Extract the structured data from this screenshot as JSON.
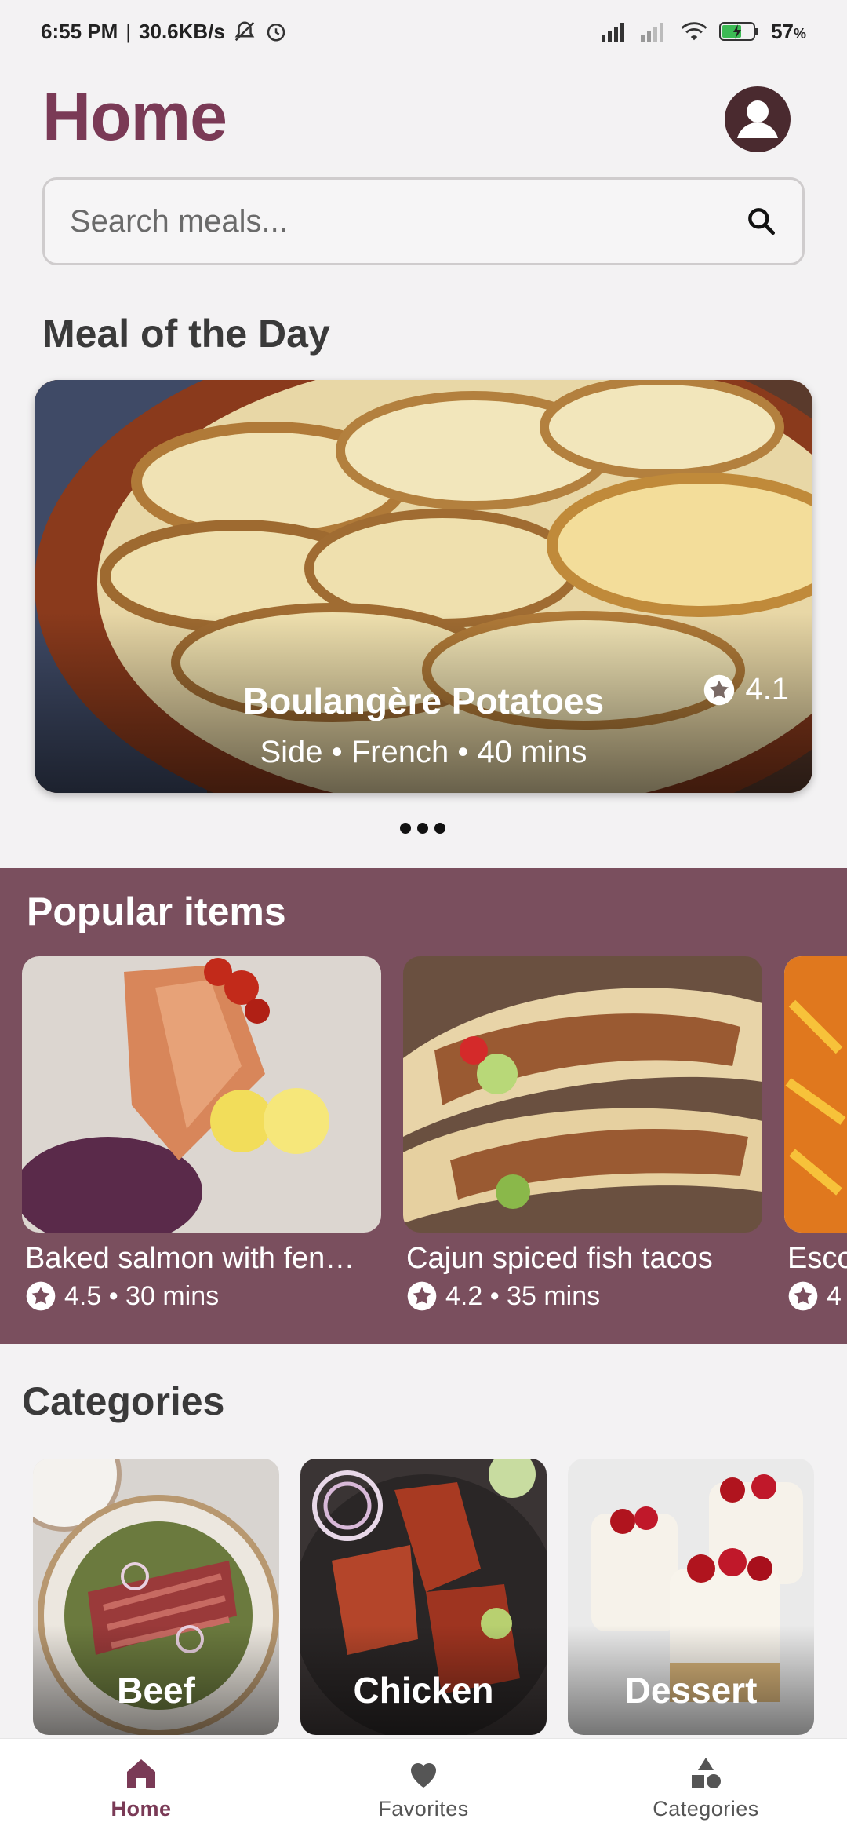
{
  "status_bar": {
    "time": "6:55 PM",
    "speed": "30.6KB/s",
    "battery": "57",
    "battery_unit": "%"
  },
  "header": {
    "title": "Home"
  },
  "search": {
    "placeholder": "Search meals..."
  },
  "meal_of_day": {
    "section_title": "Meal of the Day",
    "name": "Boulangère Potatoes",
    "meta": "Side • French • 40 mins",
    "rating": "4.1",
    "carousel_pages": 3
  },
  "popular": {
    "title": "Popular items",
    "items": [
      {
        "name": "Baked salmon with fen…",
        "meta": "4.5 • 30 mins"
      },
      {
        "name": "Cajun spiced fish tacos",
        "meta": "4.2 • 35 mins"
      },
      {
        "name": "Esco",
        "meta": "4"
      }
    ]
  },
  "categories": {
    "title": "Categories",
    "items": [
      {
        "name": "Beef"
      },
      {
        "name": "Chicken"
      },
      {
        "name": "Dessert"
      }
    ]
  },
  "nav": {
    "items": [
      {
        "label": "Home",
        "icon": "home-icon",
        "active": true
      },
      {
        "label": "Favorites",
        "icon": "heart-icon",
        "active": false
      },
      {
        "label": "Categories",
        "icon": "shapes-icon",
        "active": false
      }
    ]
  },
  "colors": {
    "brand": "#7a3a56",
    "popular_bg": "#7a4f5e",
    "background": "#f3f2f3"
  }
}
